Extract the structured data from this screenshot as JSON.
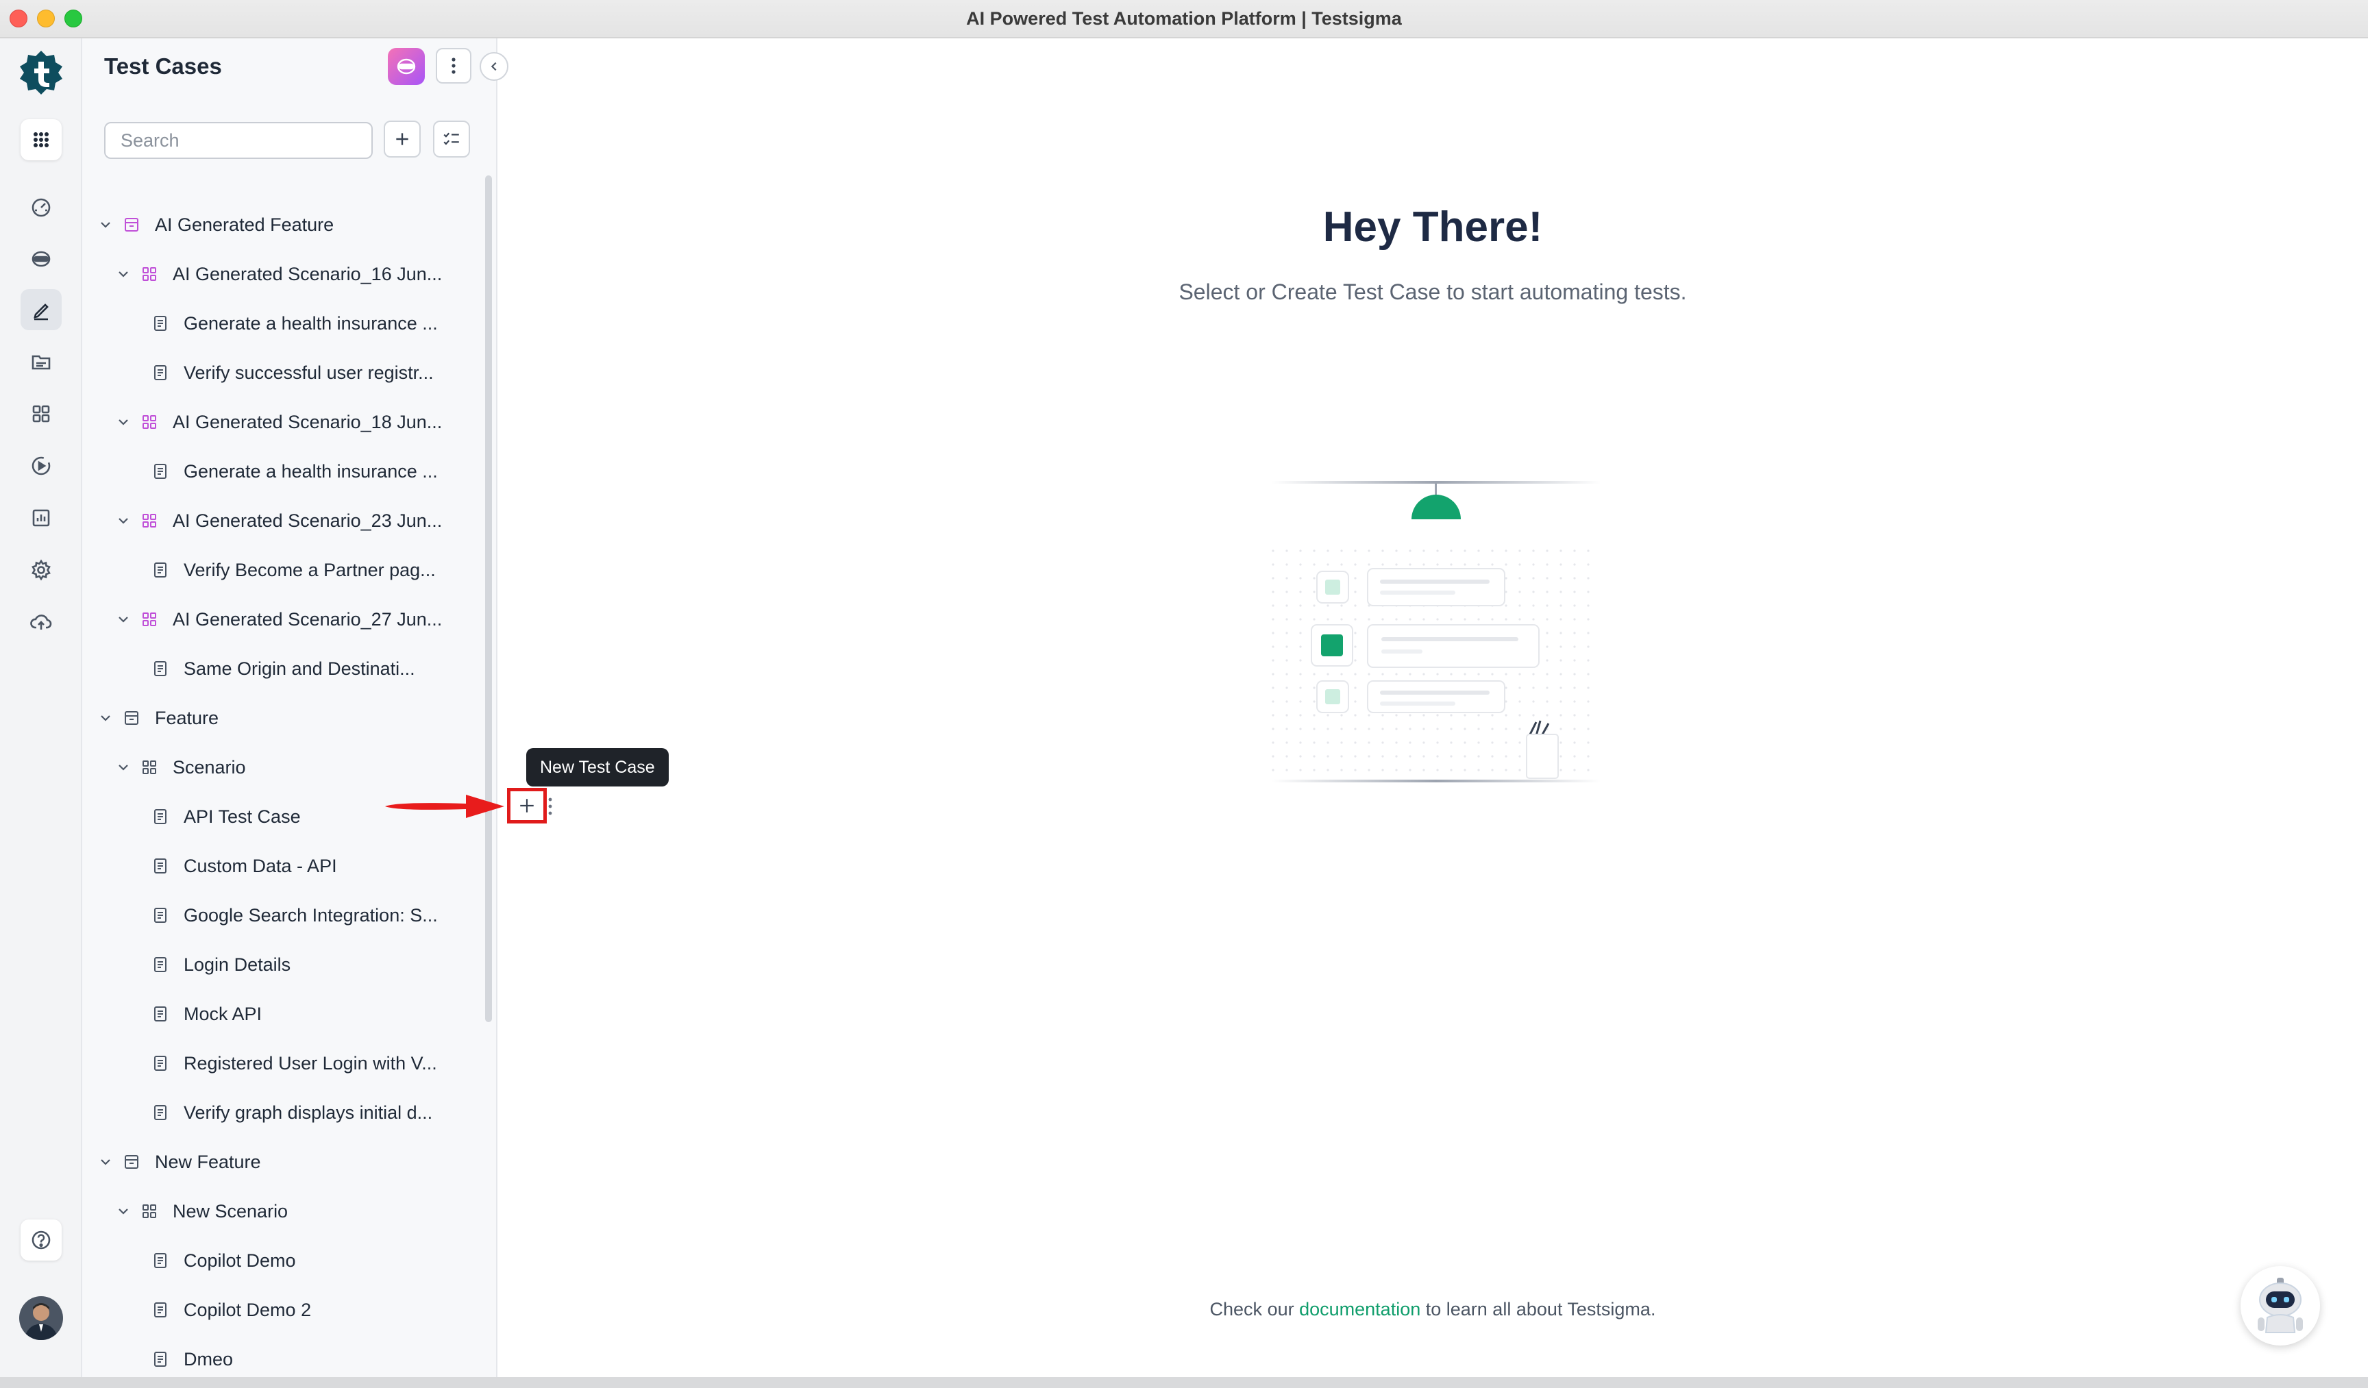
{
  "window": {
    "title": "AI Powered Test Automation Platform | Testsigma"
  },
  "rail": {
    "items": [
      {
        "icon": "apps-grid-icon"
      },
      {
        "icon": "dashboard-gauge-icon"
      },
      {
        "icon": "copilot-icon"
      },
      {
        "icon": "test-cases-pencil-icon"
      },
      {
        "icon": "test-data-folder-icon"
      },
      {
        "icon": "elements-grid-icon"
      },
      {
        "icon": "run-play-icon"
      },
      {
        "icon": "reports-chart-icon"
      },
      {
        "icon": "settings-gear-icon"
      },
      {
        "icon": "cloud-upload-icon"
      }
    ],
    "help_icon": "help-circle-icon"
  },
  "panel": {
    "title": "Test Cases",
    "search_placeholder": "Search",
    "collapse_icon": "chevron-left-icon"
  },
  "tooltip": {
    "text": "New Test Case"
  },
  "tree": [
    {
      "level": 0,
      "type": "feature",
      "label": "AI Generated Feature",
      "ai": true
    },
    {
      "level": 1,
      "type": "scenario",
      "label": "AI Generated Scenario_16 Jun...",
      "ai": true
    },
    {
      "level": 2,
      "type": "testcase",
      "label": "Generate a health insurance ..."
    },
    {
      "level": 2,
      "type": "testcase",
      "label": "Verify successful user registr..."
    },
    {
      "level": 1,
      "type": "scenario",
      "label": "AI Generated Scenario_18 Jun...",
      "ai": true
    },
    {
      "level": 2,
      "type": "testcase",
      "label": "Generate a health insurance ..."
    },
    {
      "level": 1,
      "type": "scenario",
      "label": "AI Generated Scenario_23 Jun...",
      "ai": true
    },
    {
      "level": 2,
      "type": "testcase",
      "label": "Verify Become a Partner pag..."
    },
    {
      "level": 1,
      "type": "scenario",
      "label": "AI Generated Scenario_27 Jun...",
      "ai": true
    },
    {
      "level": 2,
      "type": "testcase",
      "label": "Same Origin and Destinati..."
    },
    {
      "level": 0,
      "type": "feature",
      "label": "Feature"
    },
    {
      "level": 1,
      "type": "scenario",
      "label": "Scenario"
    },
    {
      "level": 2,
      "type": "testcase",
      "label": "API Test Case"
    },
    {
      "level": 2,
      "type": "testcase",
      "label": "Custom Data - API"
    },
    {
      "level": 2,
      "type": "testcase",
      "label": "Google Search Integration: S..."
    },
    {
      "level": 2,
      "type": "testcase",
      "label": "Login Details"
    },
    {
      "level": 2,
      "type": "testcase",
      "label": "Mock API"
    },
    {
      "level": 2,
      "type": "testcase",
      "label": "Registered User Login with V..."
    },
    {
      "level": 2,
      "type": "testcase",
      "label": "Verify graph displays initial d..."
    },
    {
      "level": 0,
      "type": "feature",
      "label": "New Feature"
    },
    {
      "level": 1,
      "type": "scenario",
      "label": "New Scenario"
    },
    {
      "level": 2,
      "type": "testcase",
      "label": "Copilot Demo"
    },
    {
      "level": 2,
      "type": "testcase",
      "label": "Copilot Demo 2"
    },
    {
      "level": 2,
      "type": "testcase",
      "label": "Dmeo"
    }
  ],
  "main": {
    "title": "Hey There!",
    "subtitle": "Select or Create Test Case to start automating tests.",
    "footer_prefix": "Check our",
    "footer_link": "documentation",
    "footer_suffix": "to learn all about Testsigma."
  },
  "colors": {
    "accent": "#0f9d6b",
    "ai_purple": "#a855f7",
    "highlight_red": "#e01b1b"
  }
}
